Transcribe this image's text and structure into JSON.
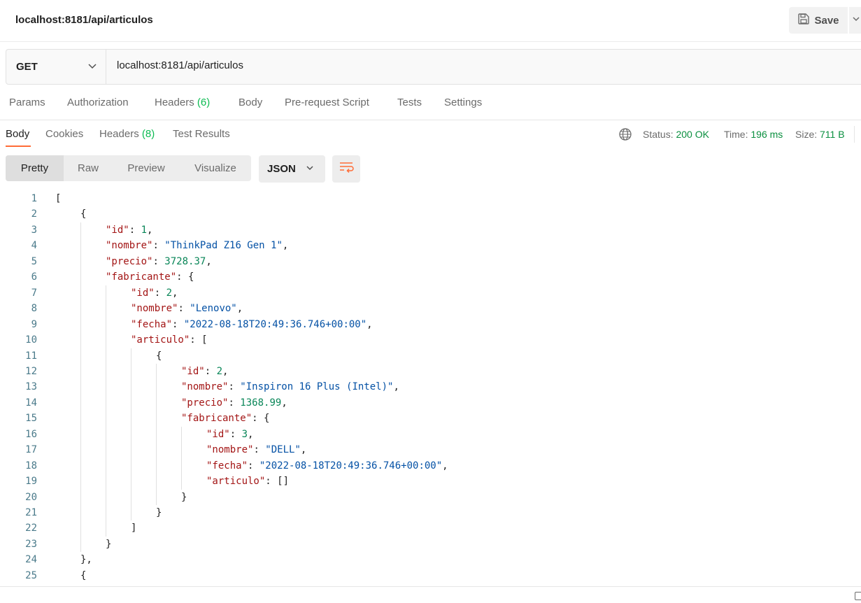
{
  "header": {
    "title": "localhost:8181/api/articulos",
    "save_label": "Save"
  },
  "request": {
    "method": "GET",
    "url": "localhost:8181/api/articulos"
  },
  "request_tabs": [
    {
      "label": "Params",
      "count": ""
    },
    {
      "label": "Authorization",
      "count": ""
    },
    {
      "label": "Headers",
      "count": "(6)"
    },
    {
      "label": "Body",
      "count": ""
    },
    {
      "label": "Pre-request Script",
      "count": ""
    },
    {
      "label": "Tests",
      "count": ""
    },
    {
      "label": "Settings",
      "count": ""
    }
  ],
  "response_tabs": [
    {
      "label": "Body",
      "count": ""
    },
    {
      "label": "Cookies",
      "count": ""
    },
    {
      "label": "Headers",
      "count": "(8)"
    },
    {
      "label": "Test Results",
      "count": ""
    }
  ],
  "response_status": {
    "status_label": "Status:",
    "status_value": "200 OK",
    "time_label": "Time:",
    "time_value": "196 ms",
    "size_label": "Size:",
    "size_value": "711 B"
  },
  "view_modes": [
    "Pretty",
    "Raw",
    "Preview",
    "Visualize"
  ],
  "format": "JSON",
  "code_lines": [
    {
      "n": "1",
      "indent": 0,
      "tokens": [
        [
          "p",
          "["
        ]
      ]
    },
    {
      "n": "2",
      "indent": 1,
      "tokens": [
        [
          "p",
          "{"
        ]
      ]
    },
    {
      "n": "3",
      "indent": 2,
      "tokens": [
        [
          "k",
          "\"id\""
        ],
        [
          "p",
          ": "
        ],
        [
          "n",
          "1"
        ],
        [
          "p",
          ","
        ]
      ]
    },
    {
      "n": "4",
      "indent": 2,
      "tokens": [
        [
          "k",
          "\"nombre\""
        ],
        [
          "p",
          ": "
        ],
        [
          "s",
          "\"ThinkPad Z16 Gen 1\""
        ],
        [
          "p",
          ","
        ]
      ]
    },
    {
      "n": "5",
      "indent": 2,
      "tokens": [
        [
          "k",
          "\"precio\""
        ],
        [
          "p",
          ": "
        ],
        [
          "n",
          "3728.37"
        ],
        [
          "p",
          ","
        ]
      ]
    },
    {
      "n": "6",
      "indent": 2,
      "tokens": [
        [
          "k",
          "\"fabricante\""
        ],
        [
          "p",
          ": {"
        ]
      ]
    },
    {
      "n": "7",
      "indent": 3,
      "tokens": [
        [
          "k",
          "\"id\""
        ],
        [
          "p",
          ": "
        ],
        [
          "n",
          "2"
        ],
        [
          "p",
          ","
        ]
      ]
    },
    {
      "n": "8",
      "indent": 3,
      "tokens": [
        [
          "k",
          "\"nombre\""
        ],
        [
          "p",
          ": "
        ],
        [
          "s",
          "\"Lenovo\""
        ],
        [
          "p",
          ","
        ]
      ]
    },
    {
      "n": "9",
      "indent": 3,
      "tokens": [
        [
          "k",
          "\"fecha\""
        ],
        [
          "p",
          ": "
        ],
        [
          "s",
          "\"2022-08-18T20:49:36.746+00:00\""
        ],
        [
          "p",
          ","
        ]
      ]
    },
    {
      "n": "10",
      "indent": 3,
      "tokens": [
        [
          "k",
          "\"articulo\""
        ],
        [
          "p",
          ": ["
        ]
      ]
    },
    {
      "n": "11",
      "indent": 4,
      "tokens": [
        [
          "p",
          "{"
        ]
      ]
    },
    {
      "n": "12",
      "indent": 5,
      "tokens": [
        [
          "k",
          "\"id\""
        ],
        [
          "p",
          ": "
        ],
        [
          "n",
          "2"
        ],
        [
          "p",
          ","
        ]
      ]
    },
    {
      "n": "13",
      "indent": 5,
      "tokens": [
        [
          "k",
          "\"nombre\""
        ],
        [
          "p",
          ": "
        ],
        [
          "s",
          "\"Inspiron 16 Plus (Intel)\""
        ],
        [
          "p",
          ","
        ]
      ]
    },
    {
      "n": "14",
      "indent": 5,
      "tokens": [
        [
          "k",
          "\"precio\""
        ],
        [
          "p",
          ": "
        ],
        [
          "n",
          "1368.99"
        ],
        [
          "p",
          ","
        ]
      ]
    },
    {
      "n": "15",
      "indent": 5,
      "tokens": [
        [
          "k",
          "\"fabricante\""
        ],
        [
          "p",
          ": {"
        ]
      ]
    },
    {
      "n": "16",
      "indent": 6,
      "tokens": [
        [
          "k",
          "\"id\""
        ],
        [
          "p",
          ": "
        ],
        [
          "n",
          "3"
        ],
        [
          "p",
          ","
        ]
      ]
    },
    {
      "n": "17",
      "indent": 6,
      "tokens": [
        [
          "k",
          "\"nombre\""
        ],
        [
          "p",
          ": "
        ],
        [
          "s",
          "\"DELL\""
        ],
        [
          "p",
          ","
        ]
      ]
    },
    {
      "n": "18",
      "indent": 6,
      "tokens": [
        [
          "k",
          "\"fecha\""
        ],
        [
          "p",
          ": "
        ],
        [
          "s",
          "\"2022-08-18T20:49:36.746+00:00\""
        ],
        [
          "p",
          ","
        ]
      ]
    },
    {
      "n": "19",
      "indent": 6,
      "tokens": [
        [
          "k",
          "\"articulo\""
        ],
        [
          "p",
          ": []"
        ]
      ]
    },
    {
      "n": "20",
      "indent": 5,
      "tokens": [
        [
          "p",
          "}"
        ]
      ]
    },
    {
      "n": "21",
      "indent": 4,
      "tokens": [
        [
          "p",
          "}"
        ]
      ]
    },
    {
      "n": "22",
      "indent": 3,
      "tokens": [
        [
          "p",
          "]"
        ]
      ]
    },
    {
      "n": "23",
      "indent": 2,
      "tokens": [
        [
          "p",
          "}"
        ]
      ]
    },
    {
      "n": "24",
      "indent": 1,
      "tokens": [
        [
          "p",
          "},"
        ]
      ]
    },
    {
      "n": "25",
      "indent": 1,
      "tokens": [
        [
          "p",
          "{"
        ]
      ]
    }
  ]
}
